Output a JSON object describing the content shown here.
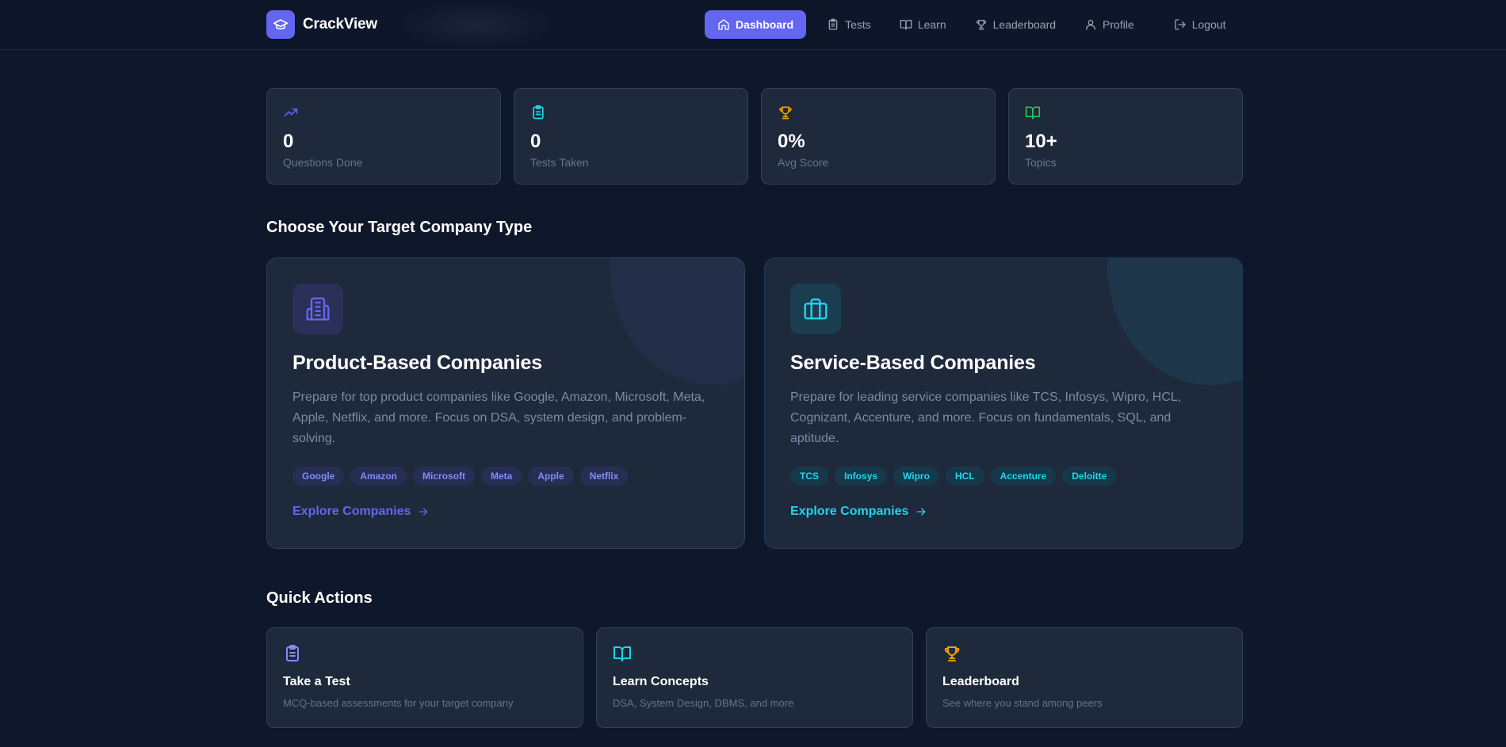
{
  "brand": {
    "name": "CrackView",
    "logo_icon": "graduation-cap-icon",
    "accent": "#6366f1"
  },
  "nav": {
    "items": [
      {
        "label": "Dashboard",
        "icon": "home-icon",
        "active": true
      },
      {
        "label": "Tests",
        "icon": "clipboard-icon"
      },
      {
        "label": "Learn",
        "icon": "book-open-icon"
      },
      {
        "label": "Leaderboard",
        "icon": "trophy-icon"
      },
      {
        "label": "Profile",
        "icon": "user-icon"
      },
      {
        "label": "Logout",
        "icon": "logout-icon"
      }
    ]
  },
  "stats": [
    {
      "value": "0",
      "label": "Questions Done",
      "icon": "trending-up-icon",
      "color": "#6366f1"
    },
    {
      "value": "0",
      "label": "Tests Taken",
      "icon": "clipboard-icon",
      "color": "#22d3ee"
    },
    {
      "value": "0%",
      "label": "Avg Score",
      "icon": "trophy-icon",
      "color": "#f59e0b"
    },
    {
      "value": "10+",
      "label": "Topics",
      "icon": "book-open-icon",
      "color": "#22c55e"
    }
  ],
  "company_section": {
    "title": "Choose Your Target Company Type",
    "cards": [
      {
        "title": "Product-Based Companies",
        "description": "Prepare for top product companies like Google, Amazon, Microsoft, Meta, Apple, Netflix, and more. Focus on DSA, system design, and problem-solving.",
        "tags": [
          "Google",
          "Amazon",
          "Microsoft",
          "Meta",
          "Apple",
          "Netflix"
        ],
        "cta": "Explore Companies",
        "icon": "building-icon",
        "color": "#6366f1"
      },
      {
        "title": "Service-Based Companies",
        "description": "Prepare for leading service companies like TCS, Infosys, Wipro, HCL, Cognizant, Accenture, and more. Focus on fundamentals, SQL, and aptitude.",
        "tags": [
          "TCS",
          "Infosys",
          "Wipro",
          "HCL",
          "Accenture",
          "Deloitte"
        ],
        "cta": "Explore Companies",
        "icon": "briefcase-icon",
        "color": "#22d3ee"
      }
    ]
  },
  "quick_actions": {
    "title": "Quick Actions",
    "items": [
      {
        "title": "Take a Test",
        "description": "MCQ-based assessments for your target company",
        "icon": "clipboard-icon",
        "color": "#818cf8"
      },
      {
        "title": "Learn Concepts",
        "description": "DSA, System Design, DBMS, and more",
        "icon": "book-open-icon",
        "color": "#22d3ee"
      },
      {
        "title": "Leaderboard",
        "description": "See where you stand among peers",
        "icon": "trophy-icon",
        "color": "#f59e0b"
      }
    ]
  }
}
